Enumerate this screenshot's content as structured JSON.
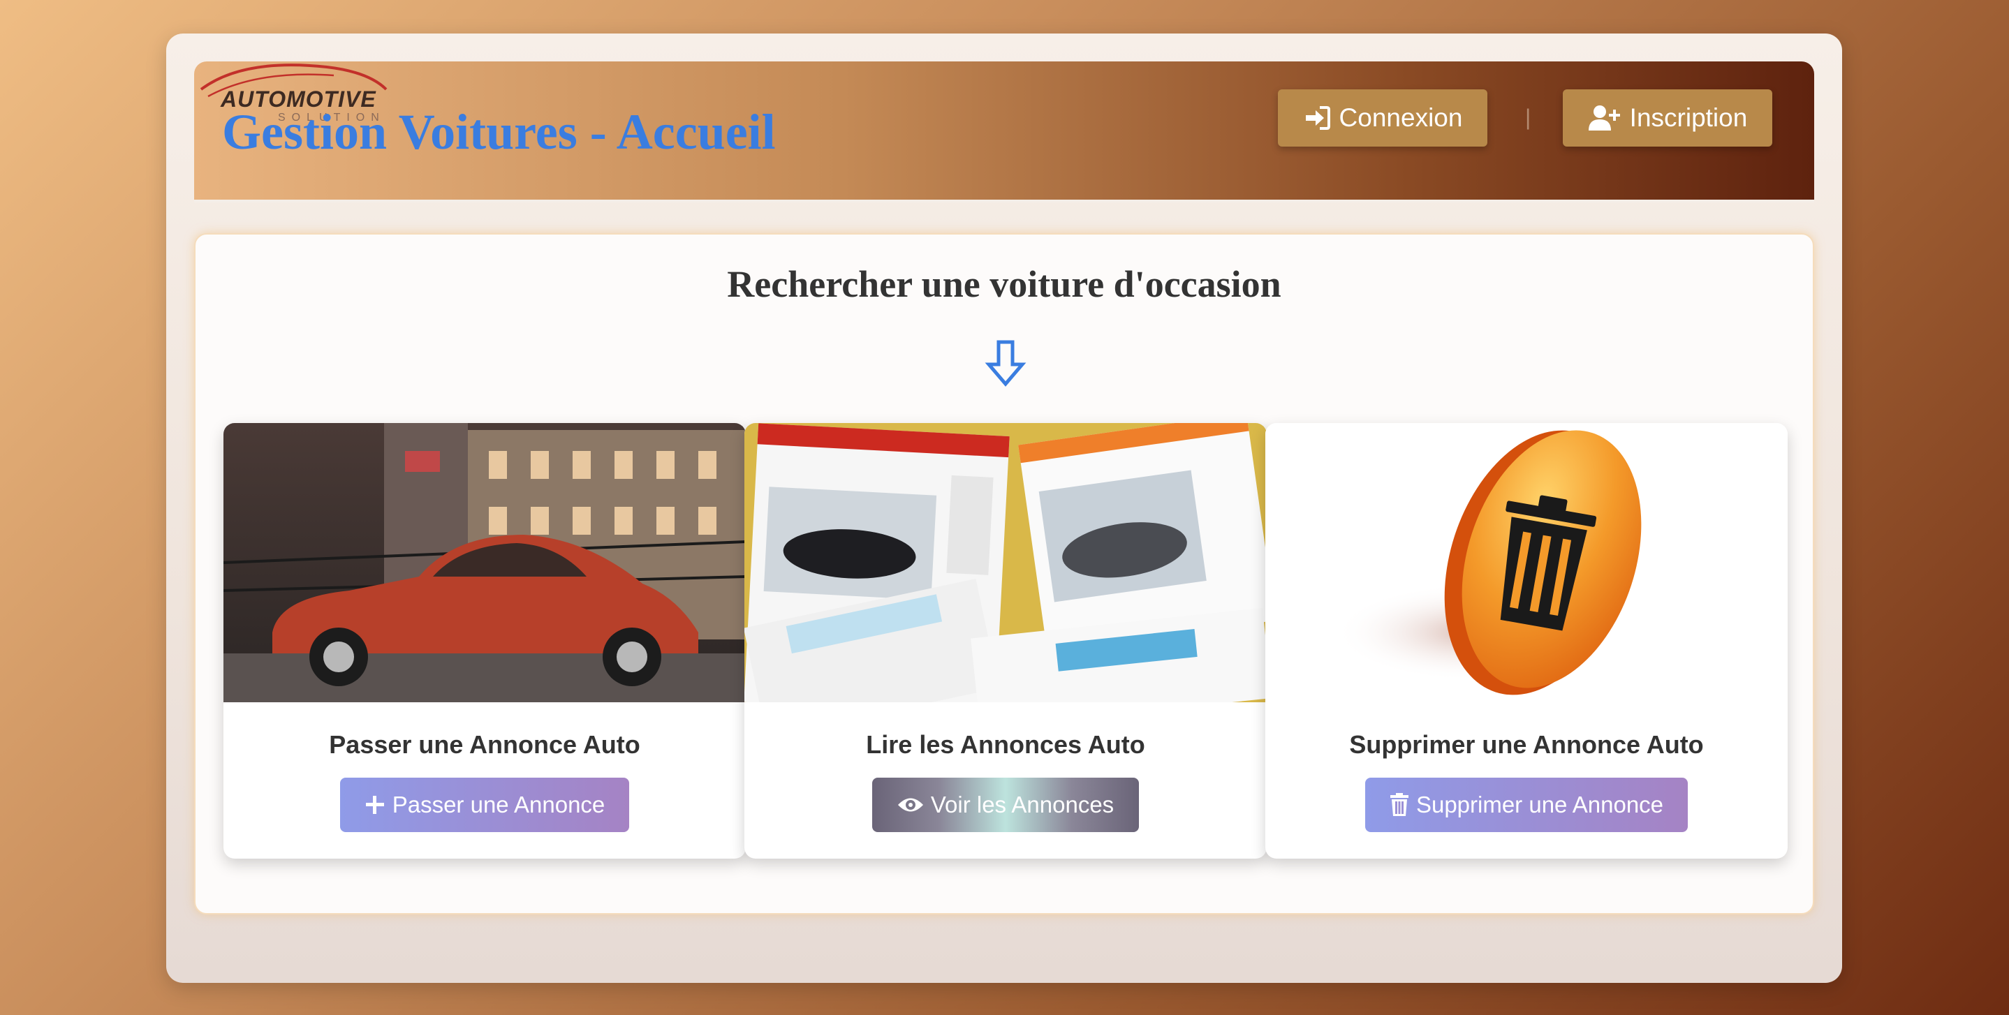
{
  "header": {
    "logo_text": "AUTOMOTIVE",
    "logo_sub": "SOLUTION",
    "title": "Gestion Voitures - Accueil",
    "login_label": "Connexion",
    "separator": "|",
    "signup_label": "Inscription"
  },
  "main": {
    "title": "Rechercher une voiture d'occasion",
    "cards": [
      {
        "title": "Passer une Annonce Auto",
        "button": "Passer une Annonce",
        "icon": "plus-icon",
        "image": "red-classic-car-photo"
      },
      {
        "title": "Lire les Annonces Auto",
        "button": "Voir les Annonces",
        "icon": "eye-icon",
        "image": "listing-websites-collage"
      },
      {
        "title": "Supprimer une Annonce Auto",
        "button": "Supprimer une Annonce",
        "icon": "trash-icon",
        "image": "orange-trash-coin"
      }
    ]
  },
  "colors": {
    "title_blue": "#3a7de0",
    "nav_button": "#b8894a",
    "card_button_start": "#8f9be8",
    "card_button_end": "#a583c4"
  }
}
